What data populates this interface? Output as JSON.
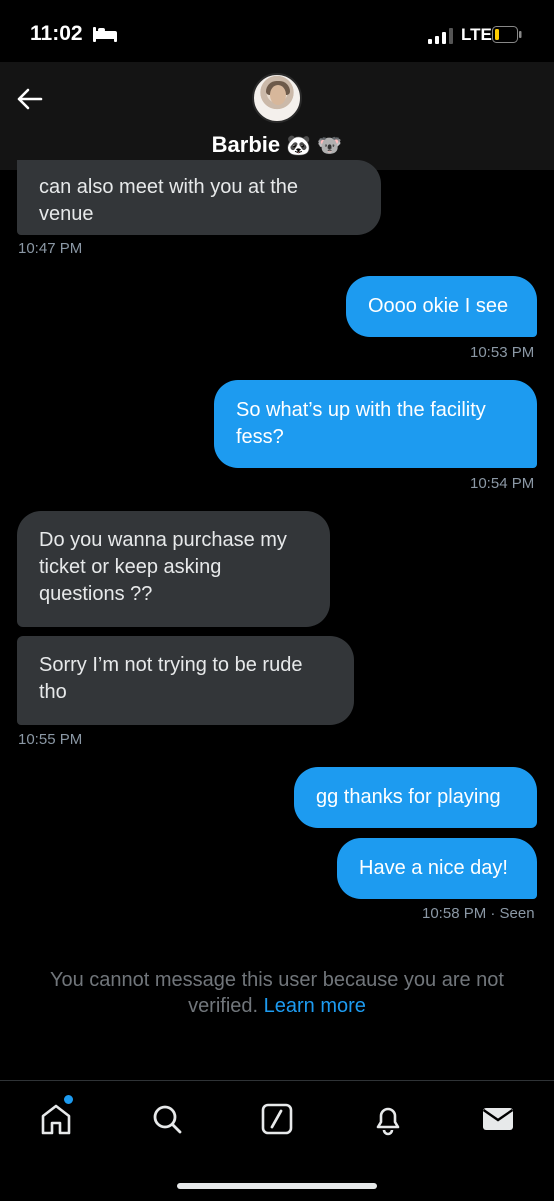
{
  "status_bar": {
    "time": "11:02",
    "network": "LTE"
  },
  "header": {
    "name": "Barbie",
    "emoji": "🐼 🐨"
  },
  "messages": [
    {
      "dir": "in",
      "text_line1": "can also meet with you at the",
      "text_line2": "venue"
    },
    {
      "dir": "out",
      "text": "Oooo okie I see"
    },
    {
      "dir": "out",
      "text_line1": "So what’s up with the facility",
      "text_line2": "fess?"
    },
    {
      "dir": "in",
      "text_line1": "Do you wanna purchase my",
      "text_line2": "ticket or keep asking",
      "text_line3": "questions ??"
    },
    {
      "dir": "in",
      "text_line1": "Sorry I’m not trying  to be rude",
      "text_line2": "tho"
    },
    {
      "dir": "out",
      "text": "gg thanks for playing"
    },
    {
      "dir": "out",
      "text": "Have a nice day!"
    }
  ],
  "timestamps": [
    "10:47 PM",
    "10:53 PM",
    "10:54 PM",
    "10:55 PM",
    "10:58 PM · Seen"
  ],
  "notice": {
    "text_line1": "You cannot message this user because you are not",
    "text_line2": "verified.",
    "link": "Learn more"
  },
  "nav": [
    "home-icon",
    "search-icon",
    "grok-icon",
    "notifications-icon",
    "messages-icon"
  ],
  "colors": {
    "accent": "#1d9bf0",
    "incoming_bubble": "#333639",
    "background": "#000000"
  }
}
